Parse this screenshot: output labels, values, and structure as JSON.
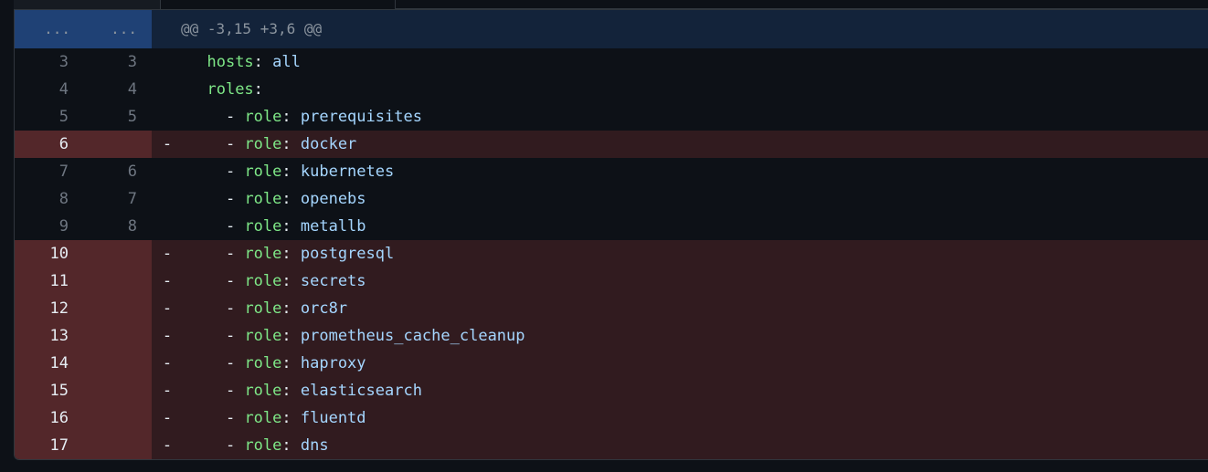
{
  "hunk": {
    "old_placeholder": "...",
    "new_placeholder": "...",
    "header": "@@ -3,15 +3,6 @@"
  },
  "lines": [
    {
      "old": "3",
      "new": "3",
      "type": "context",
      "marker": "",
      "indent": "  ",
      "dash": "",
      "key": "hosts",
      "sep": ":",
      "value": " all"
    },
    {
      "old": "4",
      "new": "4",
      "type": "context",
      "marker": "",
      "indent": "  ",
      "dash": "",
      "key": "roles",
      "sep": ":",
      "value": ""
    },
    {
      "old": "5",
      "new": "5",
      "type": "context",
      "marker": "",
      "indent": "    ",
      "dash": "- ",
      "key": "role",
      "sep": ":",
      "value": " prerequisites"
    },
    {
      "old": "6",
      "new": "",
      "type": "removed",
      "marker": "-",
      "indent": "    ",
      "dash": "- ",
      "key": "role",
      "sep": ":",
      "value": " docker"
    },
    {
      "old": "7",
      "new": "6",
      "type": "context",
      "marker": "",
      "indent": "    ",
      "dash": "- ",
      "key": "role",
      "sep": ":",
      "value": " kubernetes"
    },
    {
      "old": "8",
      "new": "7",
      "type": "context",
      "marker": "",
      "indent": "    ",
      "dash": "- ",
      "key": "role",
      "sep": ":",
      "value": " openebs"
    },
    {
      "old": "9",
      "new": "8",
      "type": "context",
      "marker": "",
      "indent": "    ",
      "dash": "- ",
      "key": "role",
      "sep": ":",
      "value": " metallb"
    },
    {
      "old": "10",
      "new": "",
      "type": "removed",
      "marker": "-",
      "indent": "    ",
      "dash": "- ",
      "key": "role",
      "sep": ":",
      "value": " postgresql"
    },
    {
      "old": "11",
      "new": "",
      "type": "removed",
      "marker": "-",
      "indent": "    ",
      "dash": "- ",
      "key": "role",
      "sep": ":",
      "value": " secrets"
    },
    {
      "old": "12",
      "new": "",
      "type": "removed",
      "marker": "-",
      "indent": "    ",
      "dash": "- ",
      "key": "role",
      "sep": ":",
      "value": " orc8r"
    },
    {
      "old": "13",
      "new": "",
      "type": "removed",
      "marker": "-",
      "indent": "    ",
      "dash": "- ",
      "key": "role",
      "sep": ":",
      "value": " prometheus_cache_cleanup"
    },
    {
      "old": "14",
      "new": "",
      "type": "removed",
      "marker": "-",
      "indent": "    ",
      "dash": "- ",
      "key": "role",
      "sep": ":",
      "value": " haproxy"
    },
    {
      "old": "15",
      "new": "",
      "type": "removed",
      "marker": "-",
      "indent": "    ",
      "dash": "- ",
      "key": "role",
      "sep": ":",
      "value": " elasticsearch"
    },
    {
      "old": "16",
      "new": "",
      "type": "removed",
      "marker": "-",
      "indent": "    ",
      "dash": "- ",
      "key": "role",
      "sep": ":",
      "value": " fluentd"
    },
    {
      "old": "17",
      "new": "",
      "type": "removed",
      "marker": "-",
      "indent": "    ",
      "dash": "- ",
      "key": "role",
      "sep": ":",
      "value": " dns"
    }
  ],
  "colors": {
    "background": "#0d1117",
    "hunk_gutter": "#1f4175",
    "hunk_bg": "#13233a",
    "removed_gutter": "#53272a",
    "removed_bg": "#311b1f",
    "key": "#7ee787",
    "value": "#a5d6ff"
  }
}
